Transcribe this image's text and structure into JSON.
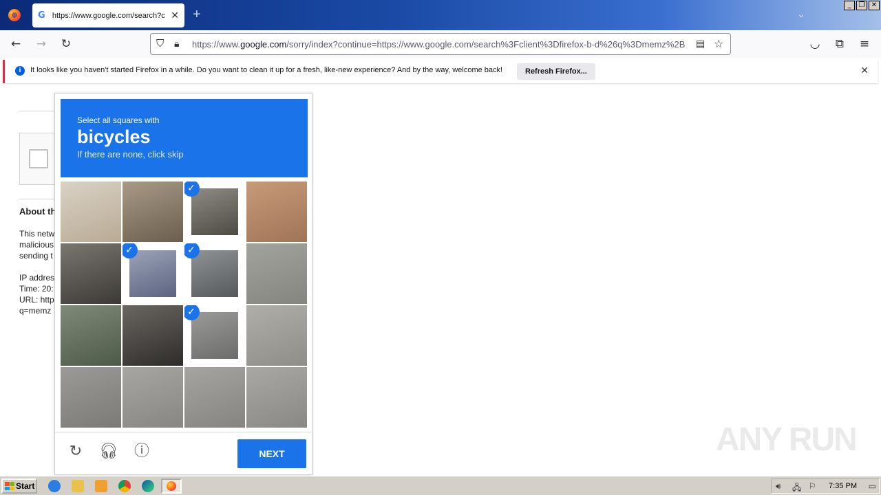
{
  "browser": {
    "tab_title": "https://www.google.com/search?c",
    "tab_favicon": "G",
    "url_pre": "https://www.",
    "url_domain": "google.com",
    "url_post": "/sorry/index?continue=https://www.google.com/search%3Fclient%3Dfirefox-b-d%26q%3Dmemz%2B",
    "notification_text": "It looks like you haven't started Firefox in a while. Do you want to clean it up for a fresh, like-new experience? And by the way, welcome back!",
    "notification_button": "Refresh Firefox..."
  },
  "page": {
    "about_heading": "About th",
    "body_text": "This netw\nmalicious\nsending t\n\nIP addres\nTime: 20:\nURL: http\nq=memz"
  },
  "captcha": {
    "instruction_pre": "Select all squares with",
    "target": "bicycles",
    "instruction_sub": "If there are none, click skip",
    "next_label": "NEXT",
    "selected_tiles": [
      2,
      5,
      6,
      10
    ],
    "accent_color": "#1a73e8"
  },
  "watermark": "ANY RUN",
  "taskbar": {
    "start_label": "Start",
    "clock": "7:35 PM"
  }
}
